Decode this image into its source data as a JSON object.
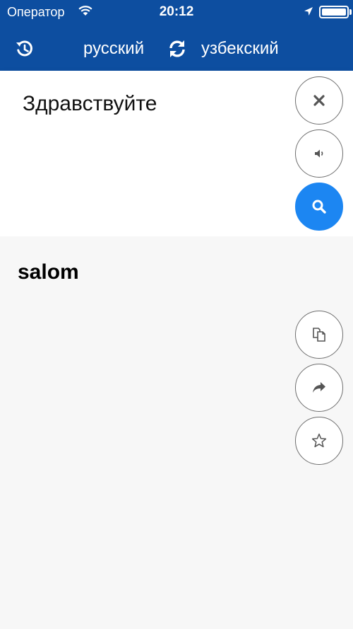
{
  "status_bar": {
    "carrier": "Оператор",
    "time": "20:12"
  },
  "nav": {
    "history_icon": "history-icon",
    "source_language": "русский",
    "swap_icon": "swap-icon",
    "target_language": "узбекский"
  },
  "input": {
    "text": "Здравствуйте",
    "buttons": [
      "clear-icon",
      "speaker-icon",
      "search-icon"
    ]
  },
  "result": {
    "text": "salom",
    "buttons": [
      "copy-icon",
      "share-icon",
      "star-icon"
    ]
  },
  "colors": {
    "header": "#0d4ea0",
    "search_button": "#1c86f2",
    "panel": "#ffffff",
    "background": "#f7f7f7"
  }
}
